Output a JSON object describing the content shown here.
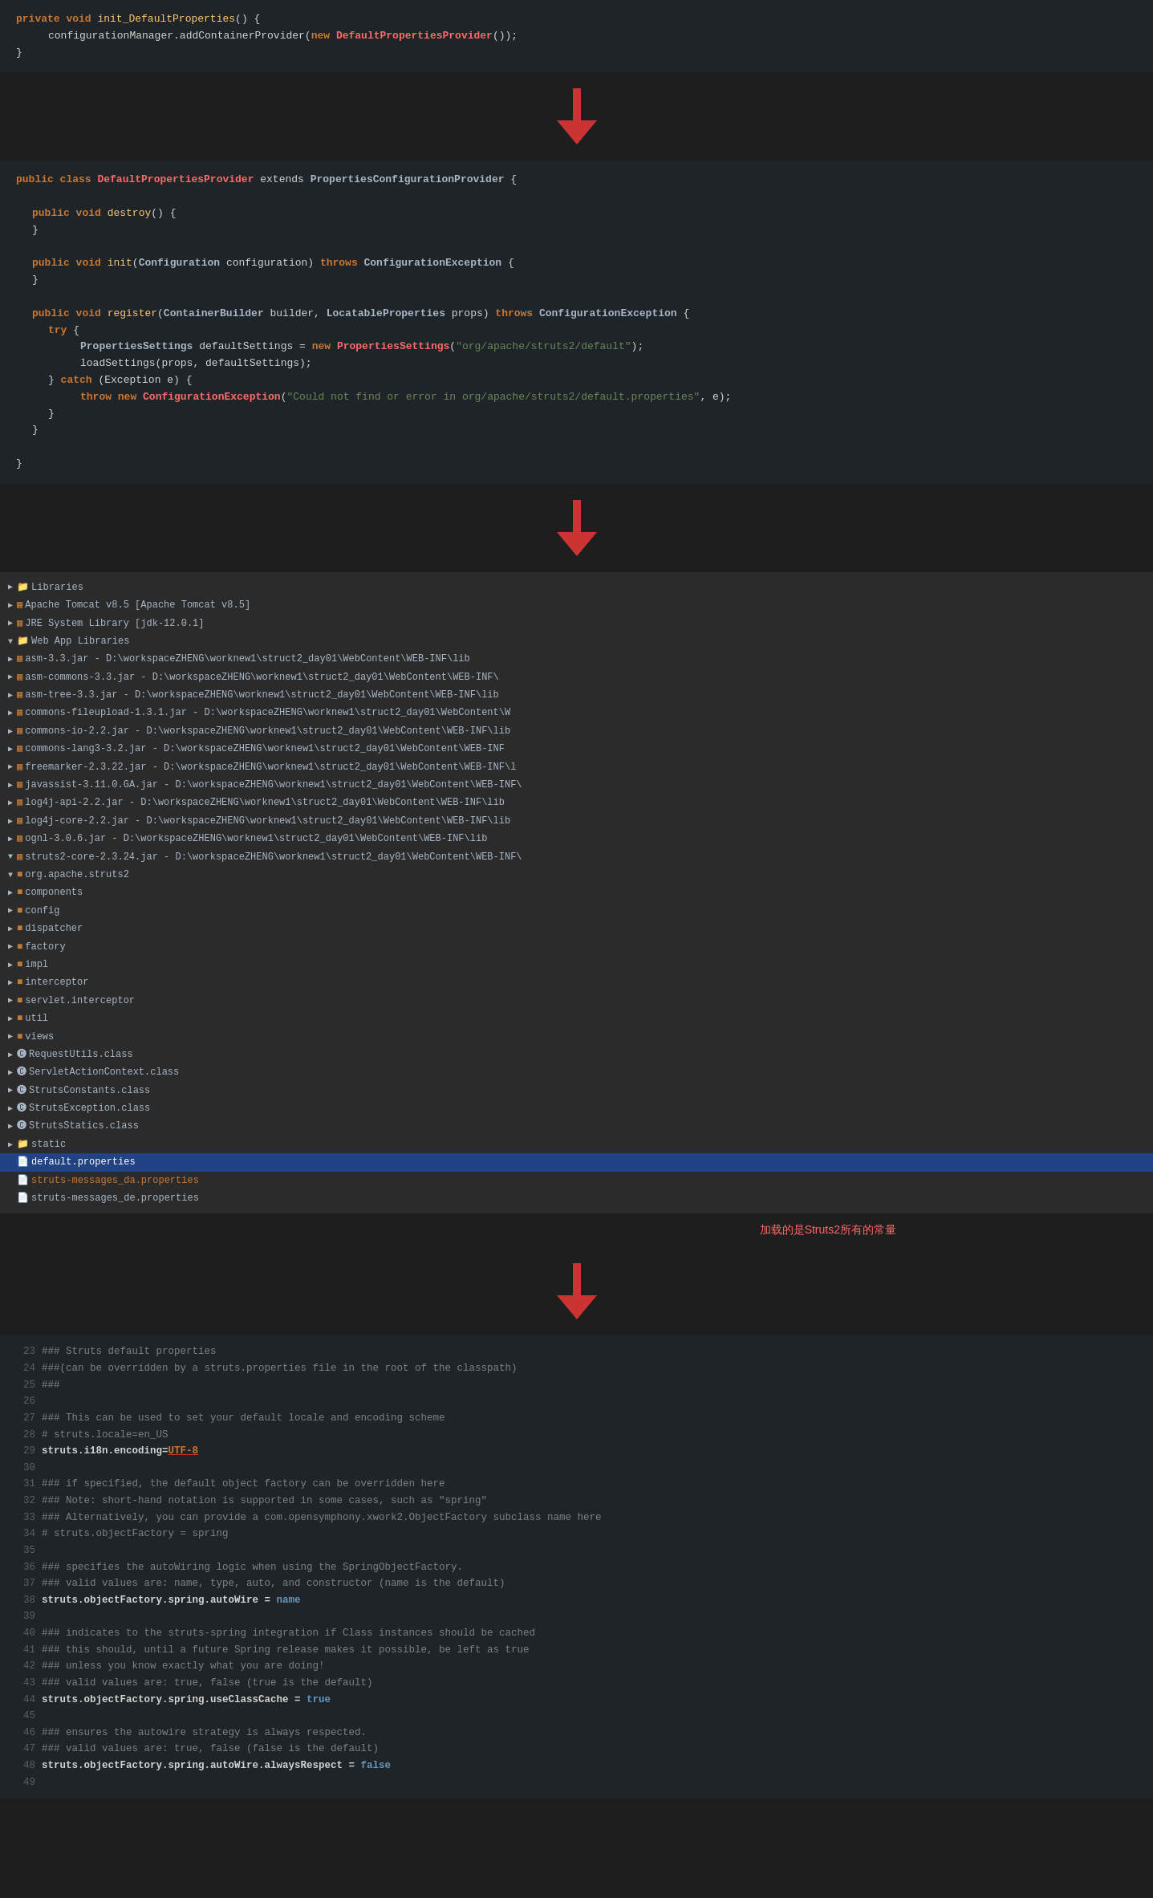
{
  "section1": {
    "lines": [
      {
        "indent": 0,
        "tokens": [
          {
            "t": "private ",
            "cls": "kw"
          },
          {
            "t": "void ",
            "cls": "kw"
          },
          {
            "t": "init_DefaultProperties",
            "cls": "fn"
          },
          {
            "t": "() {",
            "cls": ""
          }
        ]
      },
      {
        "indent": 1,
        "tokens": [
          {
            "t": "configurationManager",
            "cls": ""
          },
          {
            "t": ".addContainerProvider(",
            "cls": ""
          },
          {
            "t": "new ",
            "cls": "kw"
          },
          {
            "t": "DefaultPropertiesProvider",
            "cls": "red-fn"
          },
          {
            "t": "());",
            "cls": ""
          }
        ]
      },
      {
        "indent": 0,
        "tokens": [
          {
            "t": "}",
            "cls": ""
          }
        ]
      }
    ]
  },
  "section2": {
    "lines": [
      {
        "tokens": [
          {
            "t": "public class ",
            "cls": "kw"
          },
          {
            "t": "DefaultPropertiesProvider",
            "cls": "red-fn"
          },
          {
            "t": " extends ",
            "cls": "kw"
          },
          {
            "t": "PropertiesConfigurationProvider",
            "cls": "cls2"
          },
          {
            "t": " {",
            "cls": ""
          }
        ]
      },
      {
        "tokens": []
      },
      {
        "tokens": [
          {
            "t": "    public ",
            "cls": "kw"
          },
          {
            "t": "void ",
            "cls": "kw"
          },
          {
            "t": "destroy",
            "cls": "fn"
          },
          {
            "t": "() {",
            "cls": ""
          }
        ]
      },
      {
        "tokens": [
          {
            "t": "    }",
            "cls": ""
          }
        ]
      },
      {
        "tokens": []
      },
      {
        "tokens": [
          {
            "t": "    public ",
            "cls": "kw"
          },
          {
            "t": "void ",
            "cls": "kw"
          },
          {
            "t": "init",
            "cls": "fn"
          },
          {
            "t": "(",
            "cls": ""
          },
          {
            "t": "Configuration",
            "cls": "cls2"
          },
          {
            "t": " configuration) ",
            "cls": ""
          },
          {
            "t": "throws ",
            "cls": "kw"
          },
          {
            "t": "ConfigurationException",
            "cls": "cls2"
          },
          {
            "t": " {",
            "cls": ""
          }
        ]
      },
      {
        "tokens": [
          {
            "t": "    }",
            "cls": ""
          }
        ]
      },
      {
        "tokens": []
      },
      {
        "tokens": [
          {
            "t": "    public ",
            "cls": "kw"
          },
          {
            "t": "void ",
            "cls": "kw"
          },
          {
            "t": "register",
            "cls": "fn"
          },
          {
            "t": "(",
            "cls": ""
          },
          {
            "t": "ContainerBuilder",
            "cls": "cls2"
          },
          {
            "t": " builder, ",
            "cls": ""
          },
          {
            "t": "LocatableProperties",
            "cls": "cls2"
          },
          {
            "t": " props) ",
            "cls": ""
          },
          {
            "t": "throws ",
            "cls": "kw"
          },
          {
            "t": "ConfigurationException",
            "cls": "cls2"
          },
          {
            "t": " {",
            "cls": ""
          }
        ]
      },
      {
        "tokens": [
          {
            "t": "        try {",
            "cls": "kw2"
          }
        ]
      },
      {
        "tokens": [
          {
            "t": "            ",
            "cls": ""
          },
          {
            "t": "PropertiesSettings",
            "cls": "cls2"
          },
          {
            "t": " defaultSettings = ",
            "cls": ""
          },
          {
            "t": "new ",
            "cls": "kw"
          },
          {
            "t": "PropertiesSettings",
            "cls": "red-fn"
          },
          {
            "t": "(",
            "cls": ""
          },
          {
            "t": "\"org/apache/struts2/default\"",
            "cls": "str"
          },
          {
            "t": ");",
            "cls": ""
          }
        ]
      },
      {
        "tokens": [
          {
            "t": "            loadSettings(props, defaultSettings);",
            "cls": ""
          }
        ]
      },
      {
        "tokens": [
          {
            "t": "        } ",
            "cls": ""
          },
          {
            "t": "catch ",
            "cls": "kw"
          },
          {
            "t": "(Exception e) {",
            "cls": ""
          }
        ]
      },
      {
        "tokens": [
          {
            "t": "            ",
            "cls": ""
          },
          {
            "t": "throw ",
            "cls": "kw"
          },
          {
            "t": "new ",
            "cls": "kw"
          },
          {
            "t": "ConfigurationException",
            "cls": "red-fn"
          },
          {
            "t": "(",
            "cls": ""
          },
          {
            "t": "\"Could not find or error in org/apache/struts2/default.properties\"",
            "cls": "str"
          },
          {
            "t": ", e);",
            "cls": ""
          }
        ]
      },
      {
        "tokens": [
          {
            "t": "        }",
            "cls": ""
          }
        ]
      },
      {
        "tokens": [
          {
            "t": "    }",
            "cls": ""
          }
        ]
      },
      {
        "tokens": []
      },
      {
        "tokens": [
          {
            "t": "}",
            "cls": ""
          }
        ]
      }
    ]
  },
  "fileTree": {
    "items": [
      {
        "level": 1,
        "icon": "folder",
        "text": "Libraries",
        "expand": false
      },
      {
        "level": 2,
        "icon": "jar",
        "text": "Apache Tomcat v8.5 [Apache Tomcat v8.5]",
        "expand": true
      },
      {
        "level": 2,
        "icon": "jar",
        "text": "JRE System Library [jdk-12.0.1]",
        "expand": false
      },
      {
        "level": 2,
        "icon": "folder",
        "text": "Web App Libraries",
        "expand": true
      },
      {
        "level": 3,
        "icon": "jar",
        "text": "asm-3.3.jar - D:\\workspaceZHENG\\worknew1\\struct2_day01\\WebContent\\WEB-INF\\lib",
        "expand": false
      },
      {
        "level": 3,
        "icon": "jar",
        "text": "asm-commons-3.3.jar - D:\\workspaceZHENG\\worknew1\\struct2_day01\\WebContent\\WEB-INF\\",
        "expand": false
      },
      {
        "level": 3,
        "icon": "jar",
        "text": "asm-tree-3.3.jar - D:\\workspaceZHENG\\worknew1\\struct2_day01\\WebContent\\WEB-INF\\lib",
        "expand": false
      },
      {
        "level": 3,
        "icon": "jar",
        "text": "commons-fileupload-1.3.1.jar - D:\\workspaceZHENG\\worknew1\\struct2_day01\\WebContent\\W",
        "expand": false
      },
      {
        "level": 3,
        "icon": "jar",
        "text": "commons-io-2.2.jar - D:\\workspaceZHENG\\worknew1\\struct2_day01\\WebContent\\WEB-INF\\lib",
        "expand": false
      },
      {
        "level": 3,
        "icon": "jar",
        "text": "commons-lang3-3.2.jar - D:\\workspaceZHENG\\worknew1\\struct2_day01\\WebContent\\WEB-INF",
        "expand": false
      },
      {
        "level": 3,
        "icon": "jar",
        "text": "freemarker-2.3.22.jar - D:\\workspaceZHENG\\worknew1\\struct2_day01\\WebContent\\WEB-INF\\l",
        "expand": false
      },
      {
        "level": 3,
        "icon": "jar",
        "text": "javassist-3.11.0.GA.jar - D:\\workspaceZHENG\\worknew1\\struct2_day01\\WebContent\\WEB-INF\\",
        "expand": false
      },
      {
        "level": 3,
        "icon": "jar",
        "text": "log4j-api-2.2.jar - D:\\workspaceZHENG\\worknew1\\struct2_day01\\WebContent\\WEB-INF\\lib",
        "expand": false
      },
      {
        "level": 3,
        "icon": "jar",
        "text": "log4j-core-2.2.jar - D:\\workspaceZHENG\\worknew1\\struct2_day01\\WebContent\\WEB-INF\\lib",
        "expand": false
      },
      {
        "level": 3,
        "icon": "jar",
        "text": "ognl-3.0.6.jar - D:\\workspaceZHENG\\worknew1\\struct2_day01\\WebContent\\WEB-INF\\lib",
        "expand": false
      },
      {
        "level": 3,
        "icon": "jar",
        "text": "struts2-core-2.3.24.jar - D:\\workspaceZHENG\\worknew1\\struct2_day01\\WebContent\\WEB-INF\\",
        "expand": true
      },
      {
        "level": 4,
        "icon": "pkg",
        "text": "org.apache.struts2",
        "expand": true
      },
      {
        "level": 5,
        "icon": "pkg",
        "text": "components",
        "expand": false
      },
      {
        "level": 5,
        "icon": "pkg",
        "text": "config",
        "expand": false
      },
      {
        "level": 5,
        "icon": "pkg",
        "text": "dispatcher",
        "expand": false
      },
      {
        "level": 5,
        "icon": "pkg",
        "text": "factory",
        "expand": false
      },
      {
        "level": 5,
        "icon": "pkg",
        "text": "impl",
        "expand": false
      },
      {
        "level": 5,
        "icon": "pkg",
        "text": "interceptor",
        "expand": false
      },
      {
        "level": 5,
        "icon": "pkg",
        "text": "servlet.interceptor",
        "expand": false
      },
      {
        "level": 5,
        "icon": "pkg",
        "text": "util",
        "expand": false
      },
      {
        "level": 5,
        "icon": "pkg",
        "text": "views",
        "expand": false
      },
      {
        "level": 5,
        "icon": "class",
        "text": "RequestUtils.class",
        "expand": false
      },
      {
        "level": 5,
        "icon": "class",
        "text": "ServletActionContext.class",
        "expand": false
      },
      {
        "level": 5,
        "icon": "class",
        "text": "StrutsConstants.class",
        "expand": false
      },
      {
        "level": 5,
        "icon": "class",
        "text": "StrutsException.class",
        "expand": false
      },
      {
        "level": 5,
        "icon": "class",
        "text": "StrutsStatics.class",
        "expand": false
      },
      {
        "level": 4,
        "icon": "folder-static",
        "text": "static",
        "expand": false
      },
      {
        "level": 3,
        "icon": "props",
        "text": "default.properties",
        "selected": true
      },
      {
        "level": 3,
        "icon": "props-red",
        "text": "struts-messages_da.properties"
      },
      {
        "level": 3,
        "icon": "props",
        "text": "struts-messages_de.properties"
      }
    ]
  },
  "label": "加载的是Struts2所有的常量",
  "propsBlock": {
    "lines": [
      {
        "ln": "23",
        "text": "### Struts default properties",
        "cls": "comment"
      },
      {
        "ln": "24",
        "text": "###(can be overridden by a struts.properties file in the root of the classpath)",
        "cls": "comment"
      },
      {
        "ln": "25",
        "text": "###",
        "cls": "comment"
      },
      {
        "ln": "26",
        "text": "",
        "cls": ""
      },
      {
        "ln": "27",
        "text": "### This can be used to set your default locale and encoding scheme",
        "cls": "comment"
      },
      {
        "ln": "28",
        "text": "# struts.locale=en_US",
        "cls": "comment"
      },
      {
        "ln": "29",
        "text": "struts.i18n.encoding=UTF-8",
        "cls": "bold-underline"
      },
      {
        "ln": "30",
        "text": "",
        "cls": ""
      },
      {
        "ln": "31",
        "text": "### if specified, the default object factory can be overridden here",
        "cls": "comment"
      },
      {
        "ln": "32",
        "text": "### Note: short-hand notation is supported in some cases, such as \"spring\"",
        "cls": "comment"
      },
      {
        "ln": "33",
        "text": "###       Alternatively, you can provide a com.opensymphony.xwork2.ObjectFactory subclass name here",
        "cls": "comment"
      },
      {
        "ln": "34",
        "text": "# struts.objectFactory = spring",
        "cls": "comment"
      },
      {
        "ln": "35",
        "text": "",
        "cls": ""
      },
      {
        "ln": "36",
        "text": "### specifies the autoWiring logic when using the SpringObjectFactory.",
        "cls": "comment"
      },
      {
        "ln": "37",
        "text": "### valid values are: name, type, auto, and constructor (name is the default)",
        "cls": "comment"
      },
      {
        "ln": "38",
        "text": "struts.objectFactory.spring.autoWire = name",
        "cls": "bold"
      },
      {
        "ln": "39",
        "text": "",
        "cls": ""
      },
      {
        "ln": "40",
        "text": "### indicates to the struts-spring integration if Class instances should be cached",
        "cls": "comment"
      },
      {
        "ln": "41",
        "text": "### this should, until a future Spring release makes it possible, be left as true",
        "cls": "comment"
      },
      {
        "ln": "42",
        "text": "### unless you know exactly what you are doing!",
        "cls": "comment"
      },
      {
        "ln": "43",
        "text": "### valid values are: true, false (true is the default)",
        "cls": "comment"
      },
      {
        "ln": "44",
        "text": "struts.objectFactory.spring.useClassCache = true",
        "cls": "bold"
      },
      {
        "ln": "45",
        "text": "",
        "cls": ""
      },
      {
        "ln": "46",
        "text": "### ensures the autowire strategy is always respected.",
        "cls": "comment"
      },
      {
        "ln": "47",
        "text": "### valid values are: true, false (false is the default)",
        "cls": "comment"
      },
      {
        "ln": "48",
        "text": "struts.objectFactory.spring.autoWire.alwaysRespect = false",
        "cls": "bold"
      },
      {
        "ln": "49",
        "text": "",
        "cls": ""
      }
    ]
  }
}
